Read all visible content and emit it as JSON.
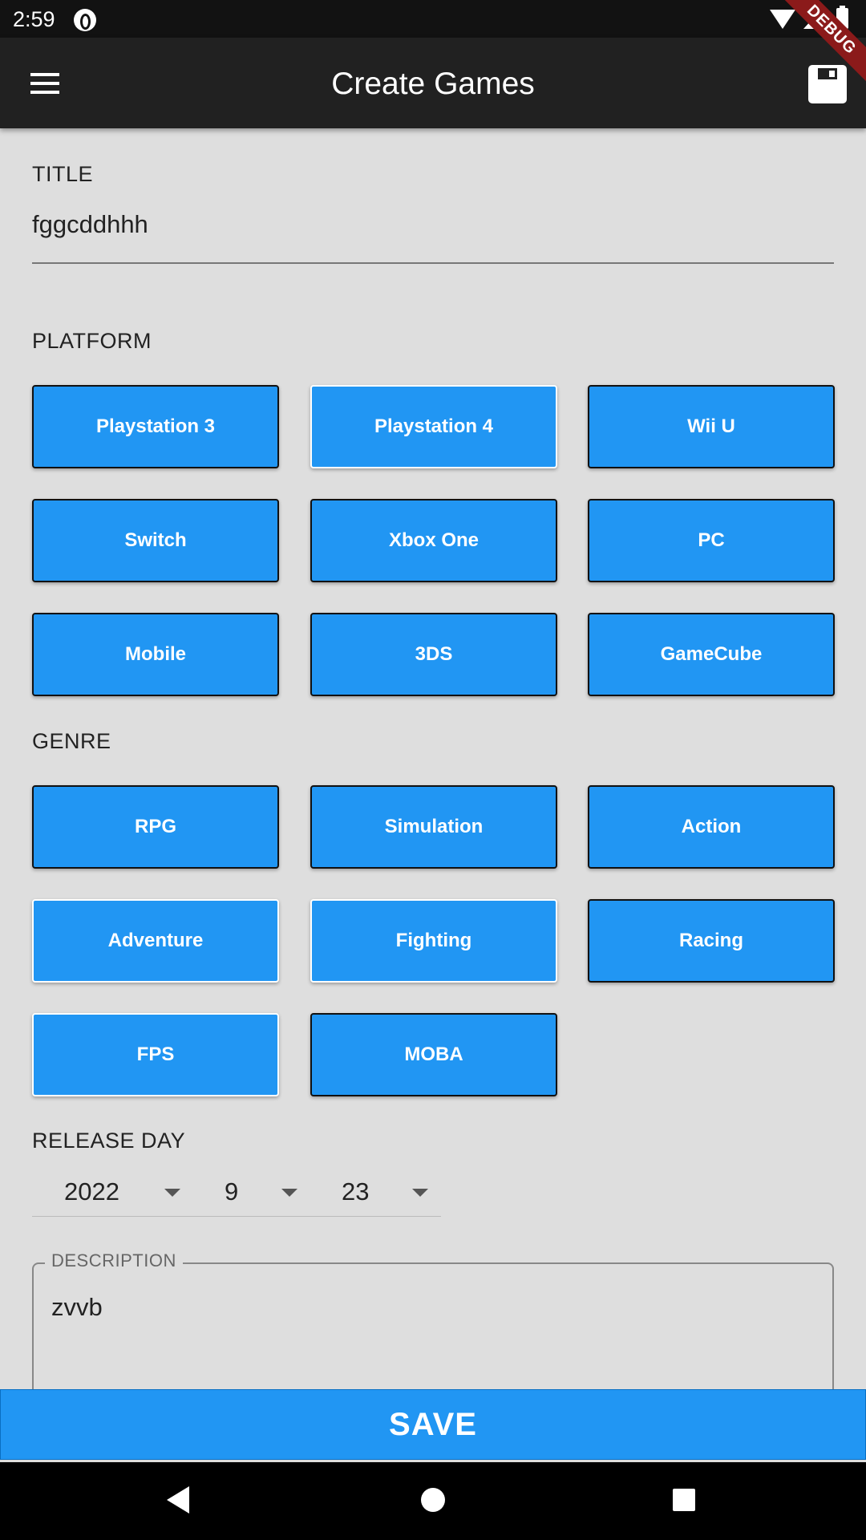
{
  "status_bar": {
    "time": "2:59"
  },
  "debug_banner": "DEBUG",
  "app_bar": {
    "title": "Create Games",
    "menu_icon": "menu-icon",
    "save_icon": "save-icon"
  },
  "form": {
    "title_label": "TITLE",
    "title_value": "fggcddhhh",
    "platform_label": "PLATFORM",
    "platforms": [
      {
        "label": "Playstation 3",
        "selected": false
      },
      {
        "label": "Playstation 4",
        "selected": true
      },
      {
        "label": "Wii U",
        "selected": false
      },
      {
        "label": "Switch",
        "selected": false
      },
      {
        "label": "Xbox One",
        "selected": false
      },
      {
        "label": "PC",
        "selected": false
      },
      {
        "label": "Mobile",
        "selected": false
      },
      {
        "label": "3DS",
        "selected": false
      },
      {
        "label": "GameCube",
        "selected": false
      }
    ],
    "genre_label": "GENRE",
    "genres": [
      {
        "label": "RPG",
        "selected": false
      },
      {
        "label": "Simulation",
        "selected": false
      },
      {
        "label": "Action",
        "selected": false
      },
      {
        "label": "Adventure",
        "selected": true
      },
      {
        "label": "Fighting",
        "selected": true
      },
      {
        "label": "Racing",
        "selected": false
      },
      {
        "label": "FPS",
        "selected": true
      },
      {
        "label": "MOBA",
        "selected": false
      }
    ],
    "release_label": "RELEASE DAY",
    "release_year": "2022",
    "release_month": "9",
    "release_day": "23",
    "description_label": "DESCRIPTION",
    "description_value": "zvvb",
    "save_button": "SAVE"
  },
  "colors": {
    "accent": "#2196f3",
    "app_bar": "#212121",
    "background": "#dedede",
    "debug": "#8b1a1a"
  }
}
